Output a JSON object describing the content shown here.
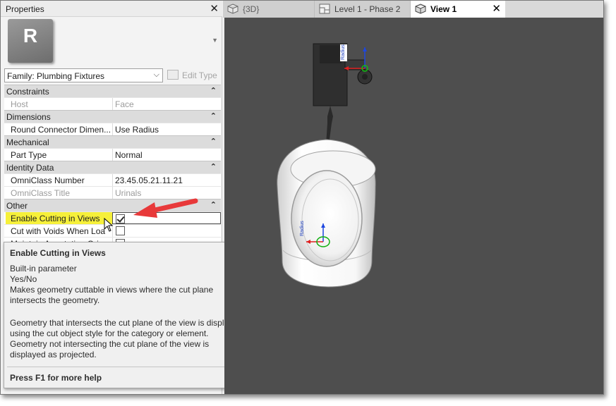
{
  "properties": {
    "title": "Properties",
    "type_icon_letter": "R",
    "family_select": "Family: Plumbing Fixtures",
    "edit_type": "Edit Type"
  },
  "categories": [
    {
      "name": "Constraints",
      "rows": [
        {
          "name": "Host",
          "value": "Face",
          "greyed": true
        }
      ]
    },
    {
      "name": "Dimensions",
      "rows": [
        {
          "name": "Round Connector Dimen...",
          "value": "Use Radius"
        }
      ]
    },
    {
      "name": "Mechanical",
      "rows": [
        {
          "name": "Part Type",
          "value": "Normal"
        }
      ]
    },
    {
      "name": "Identity Data",
      "rows": [
        {
          "name": "OmniClass Number",
          "value": "23.45.05.21.11.21"
        },
        {
          "name": "OmniClass Title",
          "value": "Urinals",
          "greyed": true
        }
      ]
    },
    {
      "name": "Other",
      "rows": [
        {
          "name": "Enable Cutting in Views",
          "checked": true
        },
        {
          "name": "Cut with Voids When Loa",
          "checked": false
        },
        {
          "name": "Maintain Annotation Orie",
          "checked": false
        }
      ]
    }
  ],
  "tooltip": {
    "title": "Enable Cutting in Views",
    "line1": "Built-in parameter",
    "line2": "Yes/No",
    "line3": "Makes geometry cuttable in views where the cut plane intersects the geometry.",
    "para2": "Geometry that intersects the cut plane of the view is displayed using the cut object style for the category or element. Geometry not intersecting the cut plane of the view is displayed as projected.",
    "help": "Press F1 for more help"
  },
  "tabs": [
    {
      "label": "{3D}",
      "icon": "cube-icon",
      "active": false
    },
    {
      "label": "Level 1 - Phase 2",
      "icon": "floor-plan-icon",
      "active": false
    },
    {
      "label": "View 1",
      "icon": "cube-icon",
      "active": true
    }
  ],
  "viewport": {
    "annotation_top": "Radius",
    "annotation_bottom": "Radius",
    "background": "#4e4e4e"
  },
  "colors": {
    "highlight": "#f6f03a",
    "arrow": "#e8393a"
  }
}
